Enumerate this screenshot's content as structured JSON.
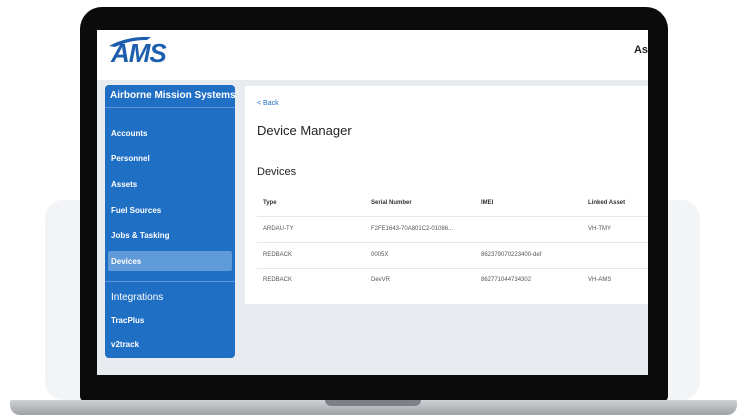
{
  "app": {
    "logo_text": "AMS",
    "user_text": "As"
  },
  "sidebar": {
    "org_name": "Airborne Mission Systems",
    "items": [
      {
        "label": "Accounts"
      },
      {
        "label": "Personnel"
      },
      {
        "label": "Assets"
      },
      {
        "label": "Fuel Sources"
      },
      {
        "label": "Jobs & Tasking"
      },
      {
        "label": "Devices"
      }
    ],
    "active_item": "Devices",
    "integrations_label": "Integrations",
    "integrations": [
      {
        "label": "TracPlus"
      },
      {
        "label": "v2track"
      }
    ]
  },
  "main": {
    "back_label": "< Back",
    "page_title": "Device Manager",
    "section_title": "Devices",
    "table": {
      "headers": [
        "Type",
        "Serial Number",
        "IMEI",
        "Linked Asset"
      ],
      "rows": [
        [
          "ARDAU-TY",
          "F2FE1643-70A801C2-01086...",
          "",
          "VH-TMY"
        ],
        [
          "REDBACK",
          "0005X",
          "862379070223400-def",
          ""
        ],
        [
          "REDBACK",
          "DevVR",
          "862771044734302",
          "VH-AMS"
        ]
      ]
    }
  },
  "colors": {
    "sidebar_bg": "#1f6fc5",
    "sidebar_active": "#5f9ad9",
    "brand": "#1d5fae",
    "screen_bg": "#e8ebef"
  }
}
